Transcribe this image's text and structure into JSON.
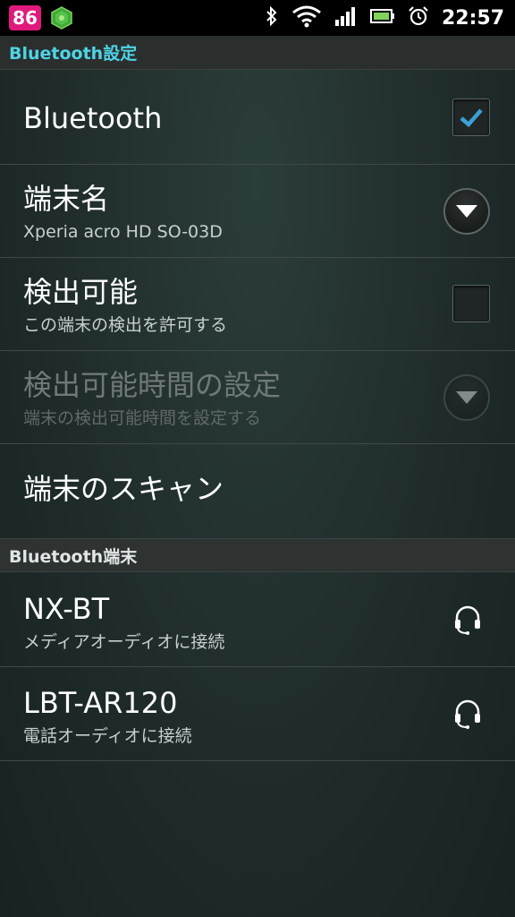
{
  "statusbar": {
    "notification_count": "86",
    "time": "22:57",
    "icons": [
      "app-icon",
      "bluetooth-icon",
      "wifi-icon",
      "signal-icon",
      "battery-icon",
      "alarm-icon"
    ]
  },
  "header": {
    "title": "Bluetooth設定"
  },
  "settings": {
    "bluetooth": {
      "label": "Bluetooth",
      "checked": true
    },
    "device_name": {
      "label": "端末名",
      "value": "Xperia acro HD SO-03D"
    },
    "discoverable": {
      "label": "検出可能",
      "summary": "この端末の検出を許可する",
      "checked": false
    },
    "discoverable_timeout": {
      "label": "検出可能時間の設定",
      "summary": "端末の検出可能時間を設定する",
      "enabled": false
    },
    "scan": {
      "label": "端末のスキャン"
    }
  },
  "devices_section": {
    "title": "Bluetooth端末"
  },
  "devices": [
    {
      "name": "NX-BT",
      "status": "メディアオーディオに接続",
      "icon": "headset-icon"
    },
    {
      "name": "LBT-AR120",
      "status": "電話オーディオに接続",
      "icon": "headset-icon"
    }
  ],
  "colors": {
    "accent": "#4fd3e6",
    "badge": "#e0197c",
    "check": "#3aa0d8"
  }
}
